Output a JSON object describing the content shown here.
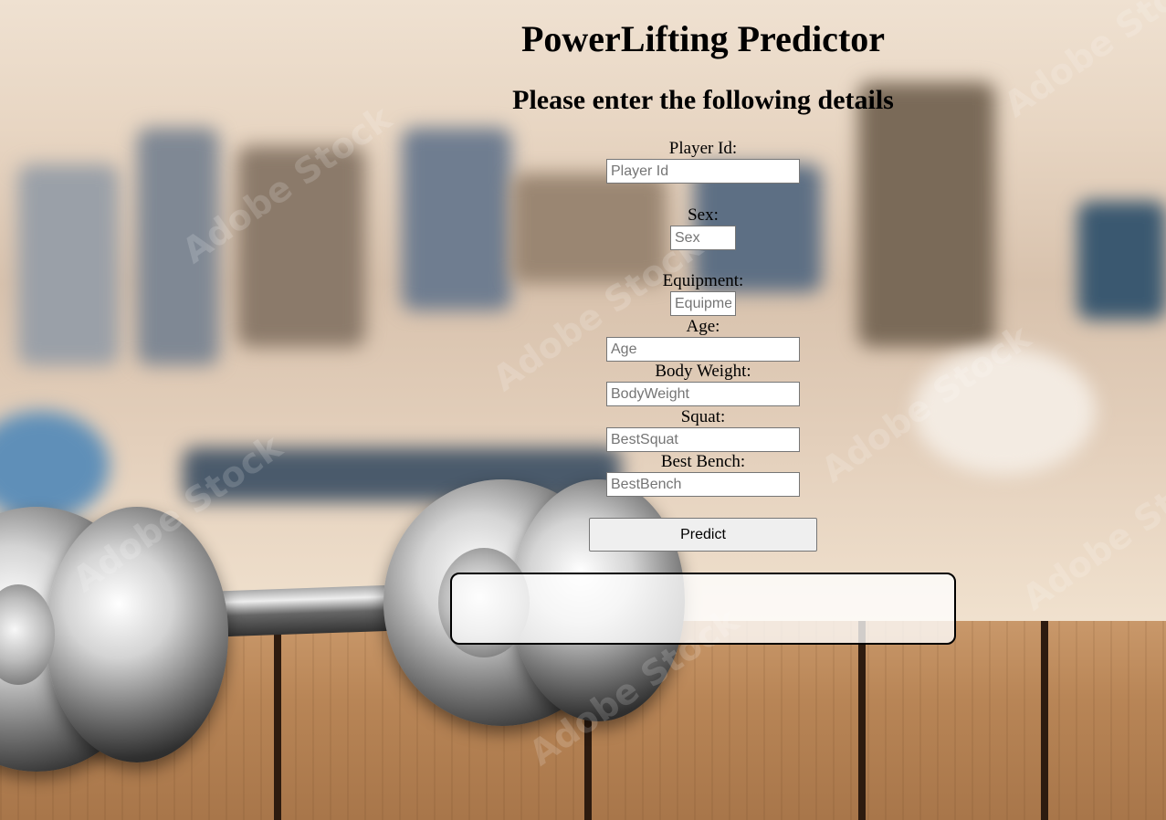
{
  "page": {
    "title": "PowerLifting Predictor",
    "subtitle": "Please enter the following details"
  },
  "form": {
    "player_id": {
      "label": "Player Id:",
      "placeholder": "Player Id",
      "value": ""
    },
    "sex": {
      "label": "Sex:",
      "placeholder": "Sex",
      "value": ""
    },
    "equipment": {
      "label": "Equipment:",
      "placeholder": "Equipment",
      "value": ""
    },
    "age": {
      "label": "Age:",
      "placeholder": "Age",
      "value": ""
    },
    "body_weight": {
      "label": "Body Weight:",
      "placeholder": "BodyWeight",
      "value": ""
    },
    "squat": {
      "label": "Squat:",
      "placeholder": "BestSquat",
      "value": ""
    },
    "best_bench": {
      "label": "Best Bench:",
      "placeholder": "BestBench",
      "value": ""
    },
    "predict_label": "Predict"
  },
  "result": {
    "text": ""
  },
  "background": {
    "watermark": "Adobe Stock",
    "icons": [
      "dumbbell-image",
      "gym-background"
    ]
  },
  "colors": {
    "text": "#000000",
    "button_bg": "#efefef",
    "result_border": "#000000"
  }
}
